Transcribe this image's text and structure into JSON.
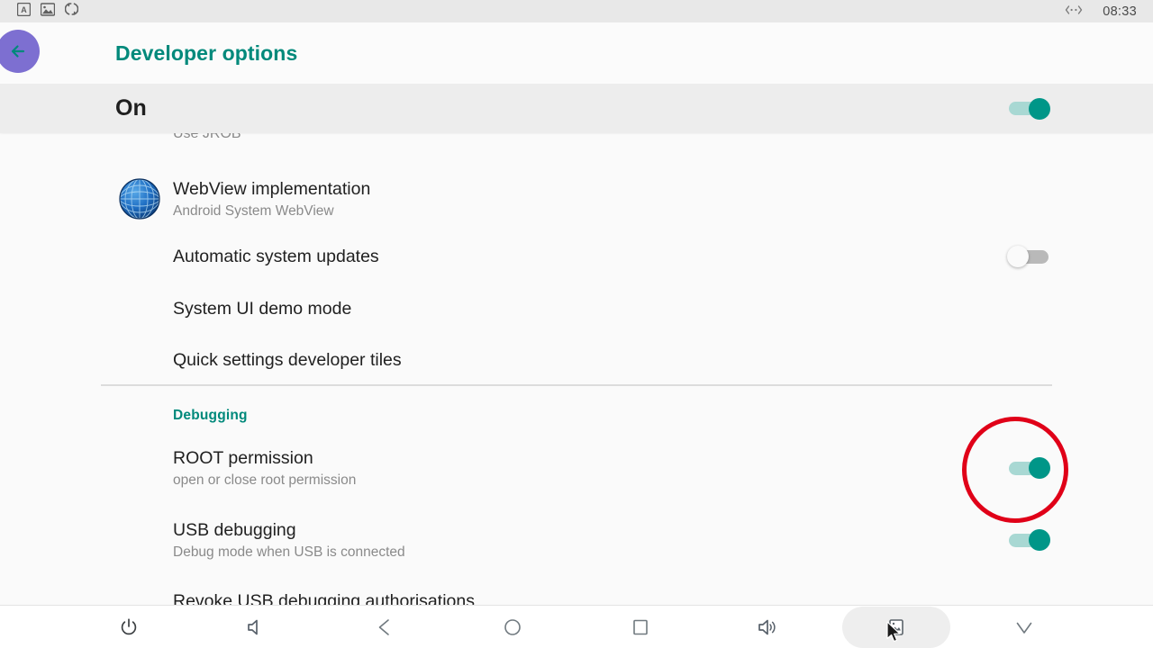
{
  "status_bar": {
    "icons": [
      {
        "name": "text-input-icon",
        "label": "A"
      },
      {
        "name": "image-icon",
        "label": "image"
      },
      {
        "name": "sync-icon",
        "label": "sync"
      }
    ],
    "right_icon": "ethernet-icon",
    "clock": "08:33"
  },
  "app_bar": {
    "back_label": "back",
    "title": "Developer options"
  },
  "master_switch": {
    "label": "On",
    "state": "on"
  },
  "settings": {
    "clipped_top_row": "Use JROB",
    "rows": [
      {
        "id": "webview-implementation",
        "title": "WebView implementation",
        "subtitle": "Android System WebView",
        "icon": "globe-icon",
        "toggle": null
      },
      {
        "id": "automatic-system-updates",
        "title": "Automatic system updates",
        "subtitle": "",
        "icon": null,
        "toggle": "off"
      },
      {
        "id": "system-ui-demo-mode",
        "title": "System UI demo mode",
        "subtitle": "",
        "icon": null,
        "toggle": null
      },
      {
        "id": "quick-settings-developer-tiles",
        "title": "Quick settings developer tiles",
        "subtitle": "",
        "icon": null,
        "toggle": null
      }
    ],
    "debugging_section": {
      "header": "Debugging",
      "rows": [
        {
          "id": "root-permission",
          "title": "ROOT permission",
          "subtitle": "open or close root permission",
          "toggle": "on",
          "highlighted": true
        },
        {
          "id": "usb-debugging",
          "title": "USB debugging",
          "subtitle": "Debug mode when USB is connected",
          "toggle": "on",
          "highlighted": false
        },
        {
          "id": "revoke-usb-debugging-authorisations",
          "title": "Revoke USB debugging authorisations",
          "subtitle": "",
          "toggle": null,
          "highlighted": false
        }
      ]
    }
  },
  "annotation": {
    "shape": "circle",
    "color": "#e00018",
    "target": "root-permission-toggle"
  },
  "nav_bar": {
    "buttons": [
      {
        "name": "power-button",
        "icon": "power-icon"
      },
      {
        "name": "volume-down-button",
        "icon": "volume-down-icon"
      },
      {
        "name": "back-nav-button",
        "icon": "triangle-left-icon"
      },
      {
        "name": "home-nav-button",
        "icon": "circle-icon"
      },
      {
        "name": "recents-nav-button",
        "icon": "square-icon"
      },
      {
        "name": "volume-up-button",
        "icon": "volume-up-icon"
      },
      {
        "name": "screenshot-button",
        "icon": "screenshot-icon"
      },
      {
        "name": "hide-navbar-button",
        "icon": "triangle-down-icon"
      }
    ]
  },
  "colors": {
    "accent_teal": "#00897b",
    "toggle_on": "#009688",
    "back_circle_purple": "#7d6fd1",
    "annotation_red": "#e00018",
    "page_bg": "#fafafa",
    "master_bar_bg": "#ededed"
  }
}
